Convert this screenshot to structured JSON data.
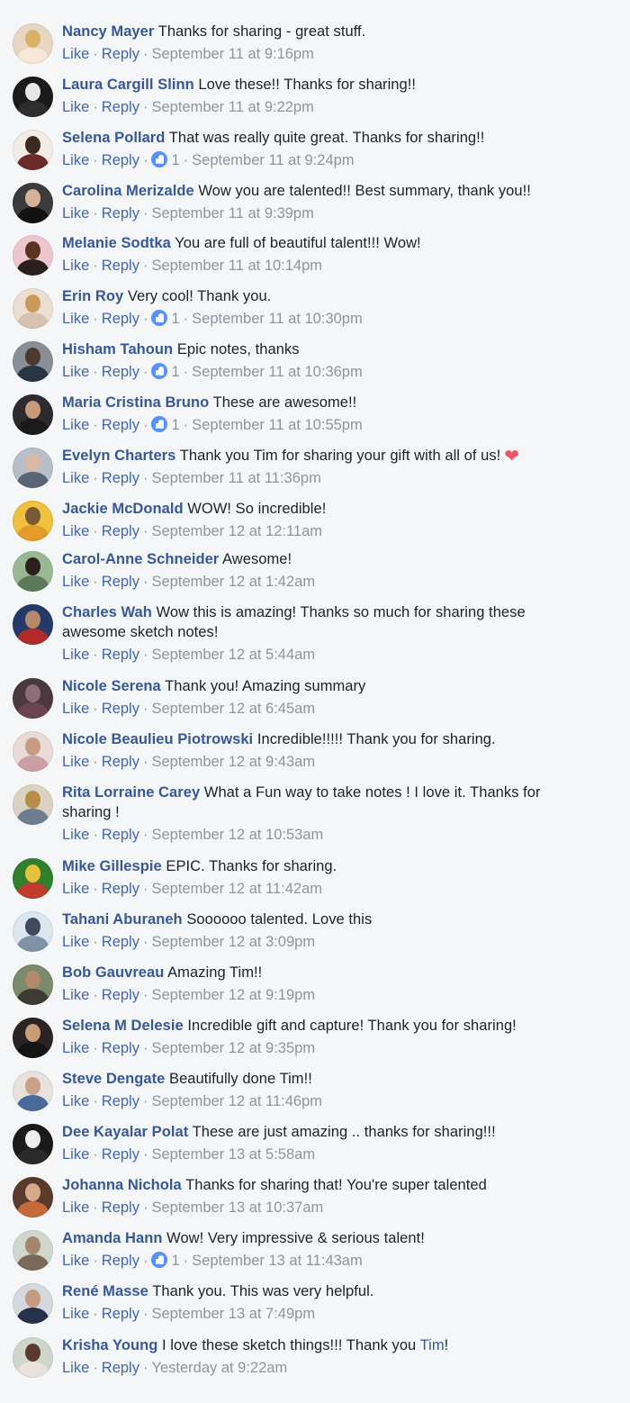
{
  "ui": {
    "like_label": "Like",
    "reply_label": "Reply",
    "separator": "·",
    "reaction_icon": "thumbs-up-icon",
    "colors": {
      "background": "#f5f6f7",
      "author_link": "#365899",
      "action_link": "#4267b2",
      "meta_text": "#90949c",
      "body_text": "#1d2129",
      "like_badge": "#5890ff",
      "heart": "#f25268"
    }
  },
  "comments": [
    {
      "author": "Nancy Mayer",
      "text": "Thanks for sharing - great stuff.",
      "time": "September 11 at 9:16pm",
      "likes": null,
      "avatar_colors": [
        "#e8d6c4",
        "#d9b26a",
        "#f6e7d8"
      ]
    },
    {
      "author": "Laura Cargill Slinn",
      "text": "Love these!! Thanks for sharing!!",
      "time": "September 11 at 9:22pm",
      "likes": null,
      "avatar_colors": [
        "#1b1b1b",
        "#e6e6e6",
        "#2e2e2e"
      ]
    },
    {
      "author": "Selena Pollard",
      "text": "That was really quite great. Thanks for sharing!!",
      "time": "September 11 at 9:24pm",
      "likes": "1",
      "avatar_colors": [
        "#f1ece6",
        "#3a2a22",
        "#6d2a2a"
      ]
    },
    {
      "author": "Carolina Merizalde",
      "text": "Wow you are talented!! Best summary, thank you!!",
      "time": "September 11 at 9:39pm",
      "likes": null,
      "avatar_colors": [
        "#3b3b3b",
        "#d4b39a",
        "#111111"
      ]
    },
    {
      "author": "Melanie Sodtka",
      "text": "You are full of beautiful talent!!! Wow!",
      "time": "September 11 at 10:14pm",
      "likes": null,
      "avatar_colors": [
        "#efc6cf",
        "#5b3322",
        "#2a1f1f"
      ]
    },
    {
      "author": "Erin Roy",
      "text": "Very cool! Thank you.",
      "time": "September 11 at 10:30pm",
      "likes": "1",
      "avatar_colors": [
        "#eadfd2",
        "#c99b58",
        "#d7c1b0"
      ]
    },
    {
      "author": "Hisham Tahoun",
      "text": "Epic notes, thanks",
      "time": "September 11 at 10:36pm",
      "likes": "1",
      "avatar_colors": [
        "#8a8f96",
        "#4b3a2f",
        "#2b3442"
      ]
    },
    {
      "author": "Maria Cristina Bruno",
      "text": "These are awesome!!",
      "time": "September 11 at 10:55pm",
      "likes": "1",
      "avatar_colors": [
        "#2c2b2e",
        "#c89a7c",
        "#1a1a1a"
      ]
    },
    {
      "author": "Evelyn Charters",
      "text": "Thank you Tim for sharing your gift with all of us!",
      "time": "September 11 at 11:36pm",
      "likes": null,
      "heart": "❤",
      "avatar_colors": [
        "#b9bfc8",
        "#d9b9a3",
        "#5a6575"
      ]
    },
    {
      "author": "Jackie McDonald",
      "text": "WOW! So incredible!",
      "time": "September 12 at 12:11am",
      "likes": null,
      "avatar_colors": [
        "#f0c13c",
        "#7a5a35",
        "#e39b2a"
      ]
    },
    {
      "author": "Carol-Anne Schneider",
      "text": "Awesome!",
      "time": "September 12 at 1:42am",
      "likes": null,
      "avatar_colors": [
        "#9ab894",
        "#2a211c",
        "#5b7a58"
      ]
    },
    {
      "author": "Charles Wah",
      "text": "Wow this is amazing! Thanks so much for sharing these awesome sketch notes!",
      "time": "September 12 at 5:44am",
      "likes": null,
      "avatar_colors": [
        "#243b6a",
        "#b58a6a",
        "#b22a2a"
      ]
    },
    {
      "author": "Nicole Serena",
      "text": "Thank you! Amazing summary",
      "time": "September 12 at 6:45am",
      "likes": null,
      "avatar_colors": [
        "#4a3a3e",
        "#8a6f78",
        "#6b4450"
      ]
    },
    {
      "author": "Nicole Beaulieu Piotrowski",
      "text": "Incredible!!!!! Thank you for sharing.",
      "time": "September 12 at 9:43am",
      "likes": null,
      "avatar_colors": [
        "#e9dcd8",
        "#c69b82",
        "#caa0a5"
      ]
    },
    {
      "author": "Rita Lorraine Carey",
      "text": "What a Fun way to take notes ! I love it. Thanks for sharing !",
      "time": "September 12 at 10:53am",
      "likes": null,
      "avatar_colors": [
        "#dad3c4",
        "#b78c46",
        "#6e7d8f"
      ]
    },
    {
      "author": "Mike Gillespie",
      "text": "EPIC. Thanks for sharing.",
      "time": "September 12 at 11:42am",
      "likes": null,
      "avatar_colors": [
        "#2f7f2f",
        "#e5c23a",
        "#c33a2f"
      ]
    },
    {
      "author": "Tahani Aburaneh",
      "text": "Soooooo talented. Love this",
      "time": "September 12 at 3:09pm",
      "likes": null,
      "avatar_colors": [
        "#dbe6ee",
        "#3c4c5e",
        "#7f93a6"
      ]
    },
    {
      "author": "Bob Gauvreau",
      "text": "Amazing Tim!!",
      "time": "September 12 at 9:19pm",
      "likes": null,
      "avatar_colors": [
        "#7b8a6a",
        "#b08a6a",
        "#3e3a36"
      ]
    },
    {
      "author": "Selena M Delesie",
      "text": "Incredible gift and capture! Thank you for sharing!",
      "time": "September 12 at 9:35pm",
      "likes": null,
      "avatar_colors": [
        "#2a2424",
        "#c89c76",
        "#141414"
      ]
    },
    {
      "author": "Steve Dengate",
      "text": "Beautifully done Tim!!",
      "time": "September 12 at 11:46pm",
      "likes": null,
      "avatar_colors": [
        "#e7e2dd",
        "#c9a088",
        "#4a6a9a"
      ]
    },
    {
      "author": "Dee Kayalar Polat",
      "text": "These are just amazing .. thanks for sharing!!!",
      "time": "September 13 at 5:58am",
      "likes": null,
      "avatar_colors": [
        "#1a1a1a",
        "#f0f0f0",
        "#2a2a2a"
      ]
    },
    {
      "author": "Johanna Nichola",
      "text": "Thanks for sharing that! You're super talented",
      "time": "September 13 at 10:37am",
      "likes": null,
      "avatar_colors": [
        "#5a3a2a",
        "#d7a88a",
        "#c76a3a"
      ]
    },
    {
      "author": "Amanda Hann",
      "text": "Wow! Very impressive & serious talent!",
      "time": "September 13 at 11:43am",
      "likes": "1",
      "avatar_colors": [
        "#cfd7cf",
        "#a4876a",
        "#7b6a5a"
      ]
    },
    {
      "author": "René Masse",
      "text": "Thank you. This was very helpful.",
      "time": "September 13 at 7:49pm",
      "likes": null,
      "avatar_colors": [
        "#d5d9de",
        "#c59b80",
        "#26324a"
      ]
    },
    {
      "author": "Krisha Young",
      "text": "I love these sketch things!!! Thank you",
      "mention": "Tim",
      "suffix": "!",
      "time": "Yesterday at 9:22am",
      "likes": null,
      "avatar_colors": [
        "#cfd6cc",
        "#5a3a2e",
        "#e9e2dc"
      ]
    }
  ]
}
